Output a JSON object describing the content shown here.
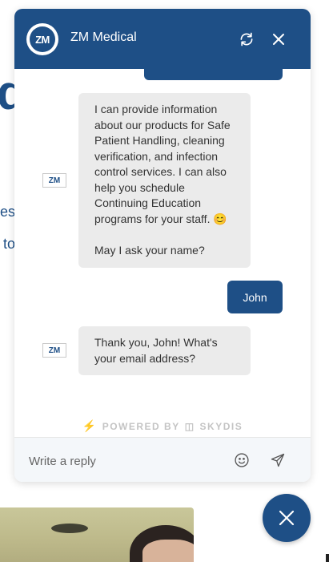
{
  "background": {
    "heading_fragment": "d",
    "line1_fragment": "es",
    "line2_fragment": "to"
  },
  "chat": {
    "logo_text": "ZM",
    "title": "ZM Medical",
    "header_icons": [
      "refresh-icon",
      "close-icon"
    ],
    "messages": [
      {
        "from": "bot",
        "avatar": "ZM",
        "text": "I can provide information about our products for Safe Patient Handling, cleaning verification, and infection control services. I can also help you schedule Continuing Education programs for your staff. 😊\n\nMay I ask your name?"
      },
      {
        "from": "user",
        "text": "John"
      },
      {
        "from": "bot",
        "avatar": "ZM",
        "text": "Thank you, John! What's your email address?"
      }
    ],
    "powered_by": "POWERED BY",
    "powered_brand": "SKYDIS",
    "composer": {
      "placeholder": "Write a reply",
      "value": "",
      "emoji_icon": "smiley-icon",
      "send_icon": "send-icon"
    }
  },
  "launcher": {
    "icon": "close-icon"
  },
  "colors": {
    "primary": "#1e4f86",
    "bot_bubble": "#ebebeb",
    "composer_bg": "#f4f7fa",
    "accent_bolt": "#f2b705"
  }
}
